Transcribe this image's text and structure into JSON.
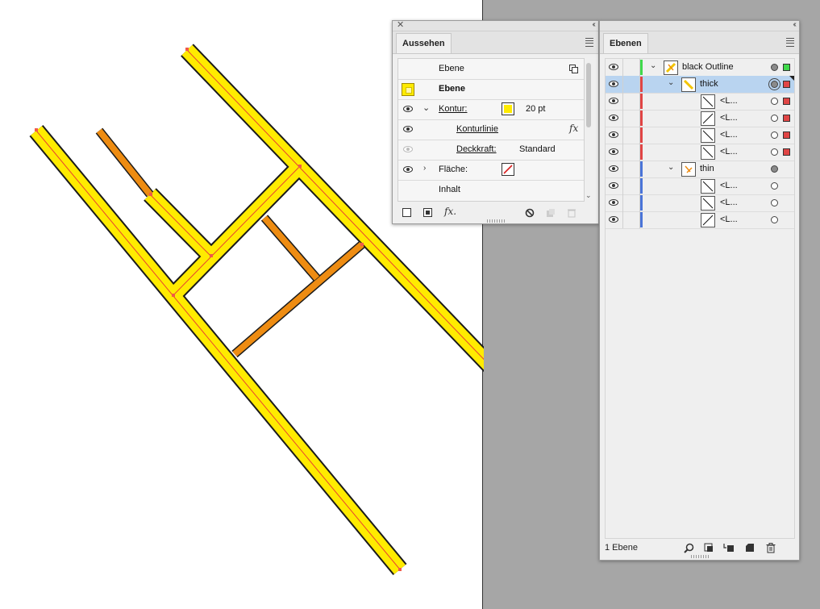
{
  "artwork": {
    "colors": {
      "stroke_fill": "#ffeb00",
      "outline": "#1a1a1a",
      "center_line": "#e8452f",
      "thin_path": "#ee8c12",
      "anchor": "#f05a4a"
    }
  },
  "appearance_panel": {
    "tab_label": "Aussehen",
    "rows": {
      "header_label": "Ebene",
      "target_label": "Ebene",
      "stroke_label": "Kontur:",
      "stroke_weight": "20 pt",
      "stroke_line_label": "Konturlinie",
      "opacity_label": "Deckkraft:",
      "opacity_value": "Standard",
      "fill_label": "Fläche:",
      "content_label": "Inhalt"
    },
    "icons": [
      "new-stroke-icon",
      "new-fill-icon",
      "fx-icon",
      "clear-appearance-icon",
      "duplicate-icon",
      "trash-icon"
    ]
  },
  "layers_panel": {
    "tab_label": "Ebenen",
    "layers": [
      {
        "name": "black Outline",
        "color": "#3fd94b",
        "level": 0
      },
      {
        "name": "thick",
        "color": "#e04545",
        "level": 1,
        "selected": true
      },
      {
        "name": "<L...",
        "color": "#e04545",
        "level": 2
      },
      {
        "name": "<L...",
        "color": "#e04545",
        "level": 2
      },
      {
        "name": "<L...",
        "color": "#e04545",
        "level": 2
      },
      {
        "name": "<L...",
        "color": "#e04545",
        "level": 2
      },
      {
        "name": "thin",
        "color": "#4a74d8",
        "level": 1
      },
      {
        "name": "<L...",
        "color": "#4a74d8",
        "level": 2
      },
      {
        "name": "<L...",
        "color": "#4a74d8",
        "level": 2
      },
      {
        "name": "<L...",
        "color": "#4a74d8",
        "level": 2
      }
    ],
    "footer": {
      "count": "1 Ebene"
    }
  }
}
